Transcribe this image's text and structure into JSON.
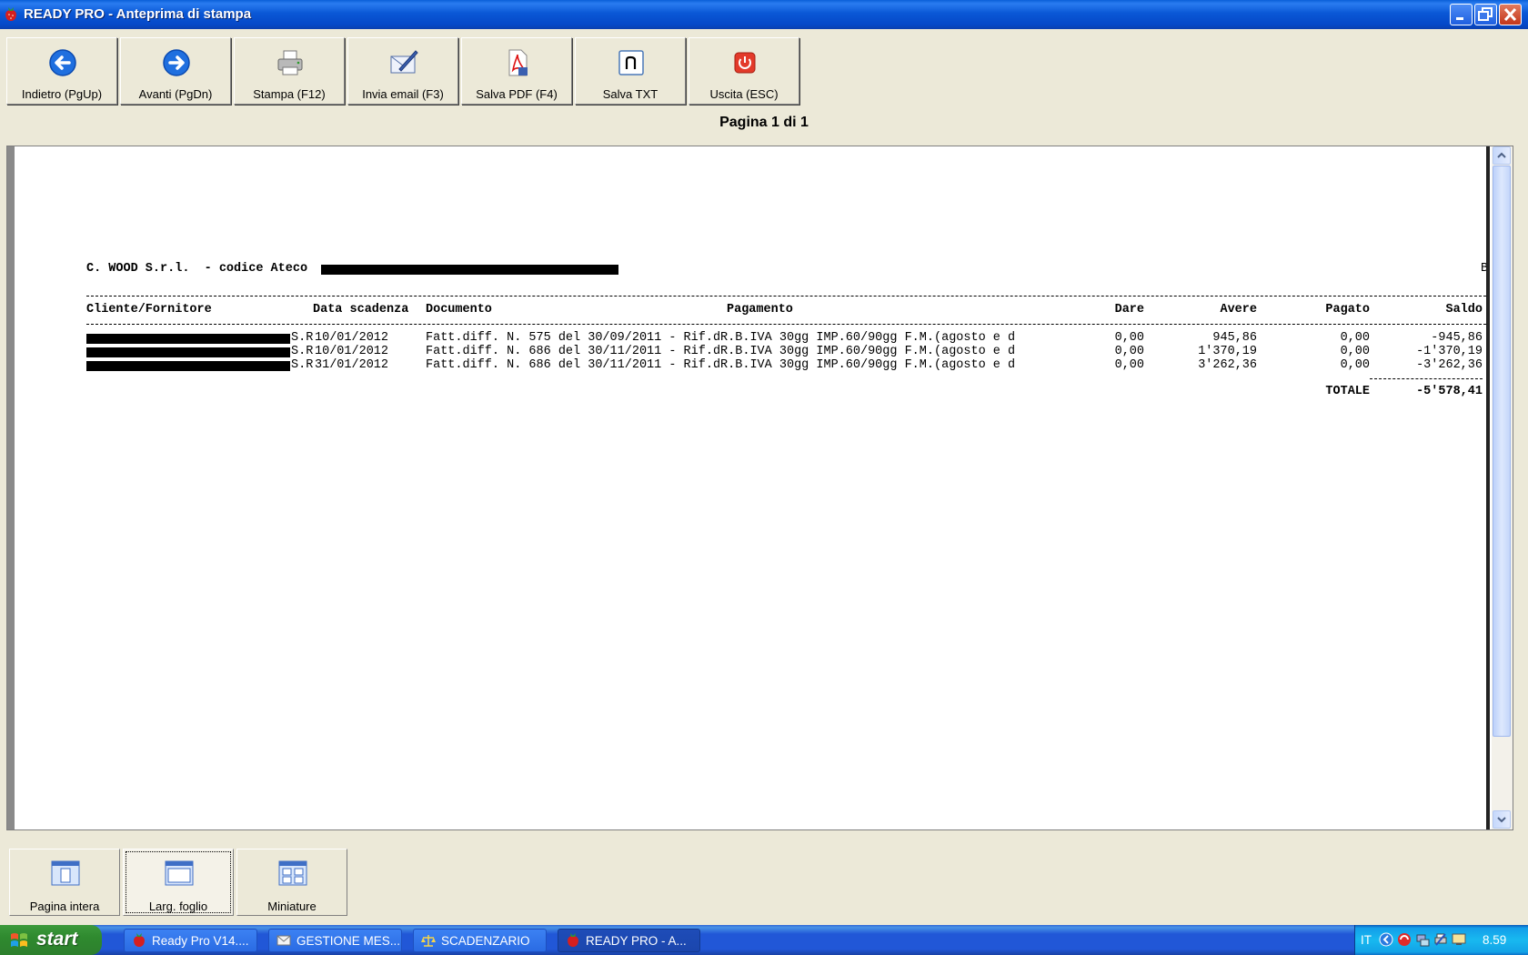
{
  "window": {
    "title": "READY PRO - Anteprima di stampa"
  },
  "toolbar": {
    "back": "Indietro (PgUp)",
    "forward": "Avanti (PgDn)",
    "print": "Stampa (F12)",
    "email": "Invia email (F3)",
    "pdf": "Salva PDF (F4)",
    "txt": "Salva TXT",
    "exit": "Uscita (ESC)"
  },
  "page_indicator": "Pagina 1 di 1",
  "document": {
    "company": "C. WOOD S.r.l.  - codice Ateco",
    "edge_char": "B",
    "headers": {
      "cliente": "Cliente/Fornitore",
      "data": "Data scadenza",
      "documento": "Documento",
      "pagamento": "Pagamento",
      "dare": "Dare",
      "avere": "Avere",
      "pagato": "Pagato",
      "saldo": "Saldo"
    },
    "rows": [
      {
        "cliente_suffix": "S.R",
        "data": "10/01/2012",
        "documento": "Fatt.diff. N. 575 del 30/09/2011 - Rif.dR.B.IVA 30gg IMP.60/90gg F.M.(agosto e d",
        "dare": "0,00",
        "avere": "945,86",
        "pagato": "0,00",
        "saldo": "-945,86"
      },
      {
        "cliente_suffix": "S.R",
        "data": "10/01/2012",
        "documento": "Fatt.diff. N. 686 del 30/11/2011 - Rif.dR.B.IVA 30gg IMP.60/90gg F.M.(agosto e d",
        "dare": "0,00",
        "avere": "1'370,19",
        "pagato": "0,00",
        "saldo": "-1'370,19"
      },
      {
        "cliente_suffix": "S.R",
        "data": "31/01/2012",
        "documento": "Fatt.diff. N. 686 del 30/11/2011 - Rif.dR.B.IVA 30gg IMP.60/90gg F.M.(agosto e d",
        "dare": "0,00",
        "avere": "3'262,36",
        "pagato": "0,00",
        "saldo": "-3'262,36"
      }
    ],
    "totale_label": "TOTALE",
    "totale_value": "-5'578,41"
  },
  "viewbar": {
    "full_page": "Pagina intera",
    "page_width": "Larg. foglio",
    "thumbnails": "Miniature"
  },
  "taskbar": {
    "start": "start",
    "tasks": [
      "Ready Pro V14....",
      "GESTIONE MES...",
      "SCADENZARIO",
      "READY PRO - A..."
    ],
    "lang": "IT",
    "clock": "8.59"
  }
}
